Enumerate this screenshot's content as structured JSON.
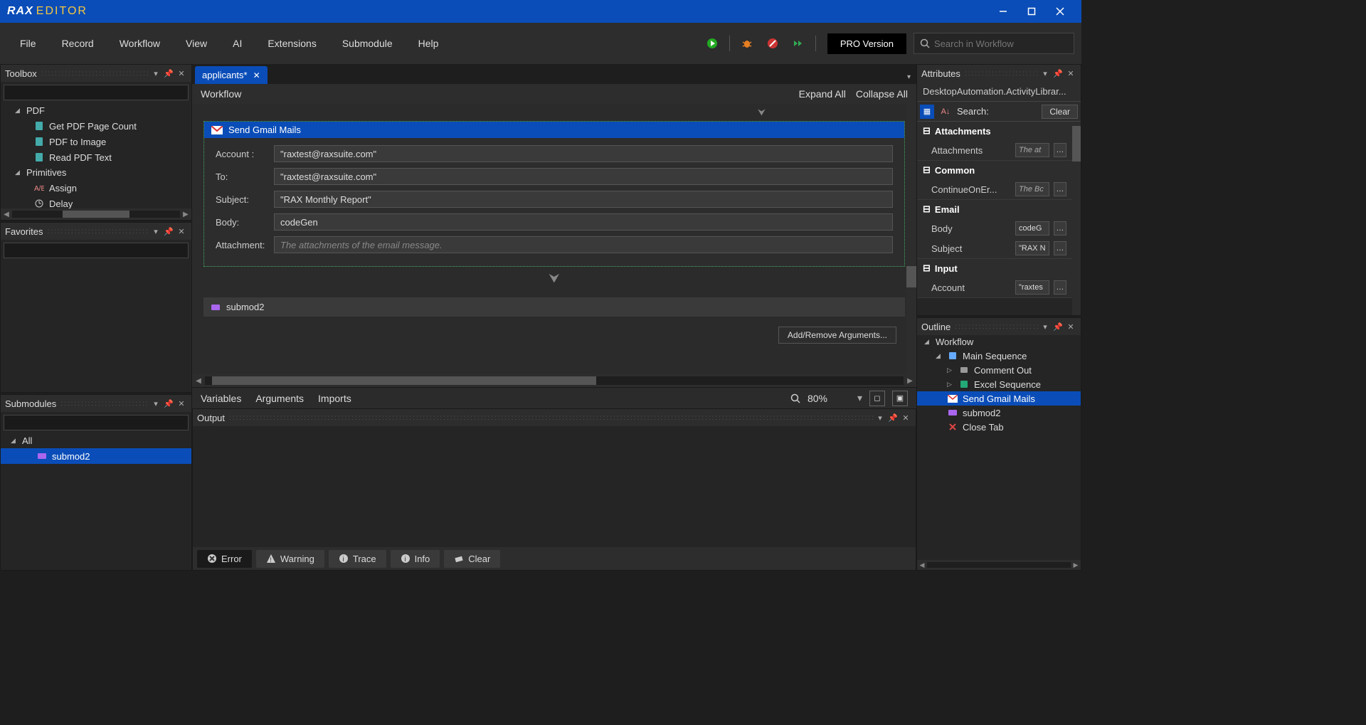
{
  "titlebar": {
    "brand1": "RAX",
    "brand2": "EDITOR"
  },
  "menu": {
    "items": [
      "File",
      "Record",
      "Workflow",
      "View",
      "AI",
      "Extensions",
      "Submodule",
      "Help"
    ],
    "pro_label": "PRO Version",
    "search_placeholder": "Search in Workflow"
  },
  "toolbox": {
    "title": "Toolbox",
    "groups": [
      {
        "name": "PDF",
        "items": [
          "Get PDF Page Count",
          "PDF to Image",
          "Read PDF Text"
        ]
      },
      {
        "name": "Primitives",
        "items": [
          "Assign",
          "Delay"
        ]
      }
    ]
  },
  "favorites": {
    "title": "Favorites"
  },
  "submodules": {
    "title": "Submodules",
    "root": "All",
    "items": [
      "submod2"
    ]
  },
  "workflow": {
    "tab_label": "applicants*",
    "heading": "Workflow",
    "expand": "Expand All",
    "collapse": "Collapse All",
    "activity_title": "Send Gmail Mails",
    "fields": {
      "account_label": "Account :",
      "account_value": "\"raxtest@raxsuite.com\"",
      "to_label": "To:",
      "to_value": "\"raxtest@raxsuite.com\"",
      "subject_label": "Subject:",
      "subject_value": "\"RAX Monthly Report\"",
      "body_label": "Body:",
      "body_value": "codeGen",
      "attachment_label": "Attachment:",
      "attachment_placeholder": "The attachments of the email message."
    },
    "sub_activity": "submod2",
    "args_button": "Add/Remove Arguments...",
    "bottom_tabs": [
      "Variables",
      "Arguments",
      "Imports"
    ],
    "zoom": "80%"
  },
  "output": {
    "title": "Output",
    "filters": [
      "Error",
      "Warning",
      "Trace",
      "Info",
      "Clear"
    ]
  },
  "attributes": {
    "title": "Attributes",
    "type_line": "DesktopAutomation.ActivityLibrar...",
    "search_label": "Search:",
    "clear_label": "Clear",
    "groups": [
      {
        "name": "Attachments",
        "rows": [
          {
            "name": "Attachments",
            "value": "",
            "placeholder": "The at"
          }
        ]
      },
      {
        "name": "Common",
        "rows": [
          {
            "name": "ContinueOnEr...",
            "value": "",
            "placeholder": "The Bc"
          }
        ]
      },
      {
        "name": "Email",
        "rows": [
          {
            "name": "Body",
            "value": "codeG",
            "placeholder": ""
          },
          {
            "name": "Subject",
            "value": "\"RAX N",
            "placeholder": ""
          }
        ]
      },
      {
        "name": "Input",
        "rows": [
          {
            "name": "Account",
            "value": "\"raxtes",
            "placeholder": ""
          }
        ]
      }
    ]
  },
  "outline": {
    "title": "Outline",
    "tree": [
      {
        "label": "Workflow",
        "level": 0
      },
      {
        "label": "Main Sequence",
        "level": 1
      },
      {
        "label": "Comment Out",
        "level": 2
      },
      {
        "label": "Excel Sequence",
        "level": 2
      },
      {
        "label": "Send Gmail Mails",
        "level": 2,
        "selected": true
      },
      {
        "label": "submod2",
        "level": 2
      },
      {
        "label": "Close Tab",
        "level": 2
      }
    ]
  }
}
